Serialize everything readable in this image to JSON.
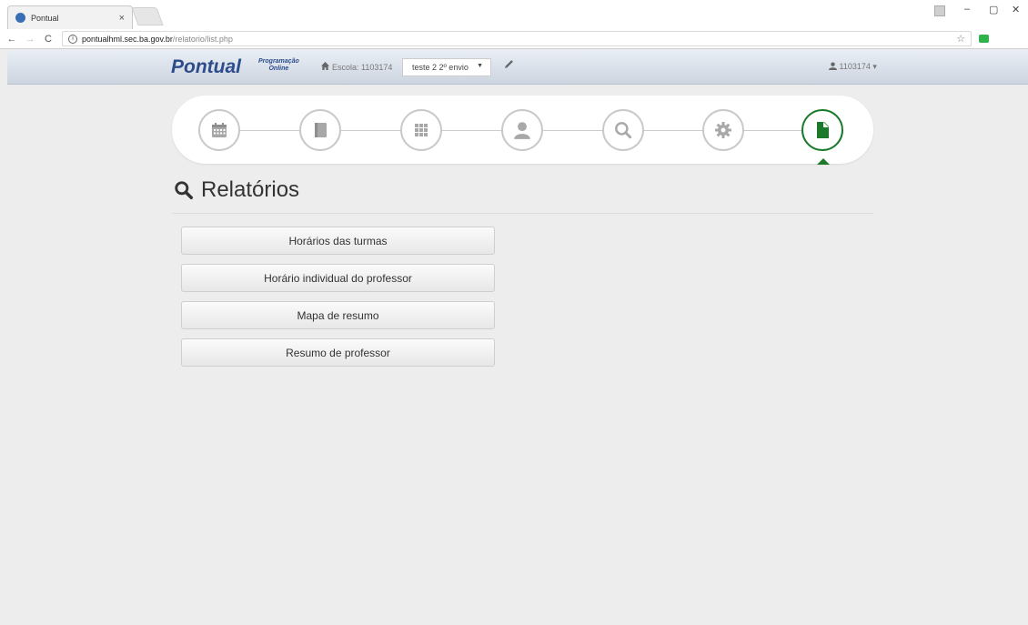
{
  "browser": {
    "tab_title": "Pontual",
    "tab_close": "×",
    "url_domain": "pontualhml.sec.ba.gov.br",
    "url_path": "/relatorio/list.php",
    "win_min": "–",
    "win_max": "▢",
    "win_close": "✕",
    "back": "←",
    "forward": "→",
    "reload": "C",
    "info": "i",
    "star": "☆"
  },
  "navbar": {
    "logo": "Pontual",
    "logo_sub_line1": "Programação",
    "logo_sub_line2": "Online",
    "escola_label": "Escola: 1103174",
    "select_value": "teste 2 2º envio",
    "user": "1103174"
  },
  "steps": [
    {
      "icon": "calendar-icon",
      "active": false
    },
    {
      "icon": "book-icon",
      "active": false
    },
    {
      "icon": "grid-icon",
      "active": false
    },
    {
      "icon": "user-icon",
      "active": false
    },
    {
      "icon": "search-icon",
      "active": false
    },
    {
      "icon": "gear-icon",
      "active": false
    },
    {
      "icon": "document-icon",
      "active": true
    }
  ],
  "page": {
    "title": "Relatórios"
  },
  "reports": [
    {
      "label": "Horários das turmas"
    },
    {
      "label": "Horário individual do professor"
    },
    {
      "label": "Mapa de resumo"
    },
    {
      "label": "Resumo de professor"
    }
  ],
  "colors": {
    "accent": "#1a7a2a",
    "brand": "#2c4c8c",
    "inactive_icon": "#a8a8a8"
  }
}
